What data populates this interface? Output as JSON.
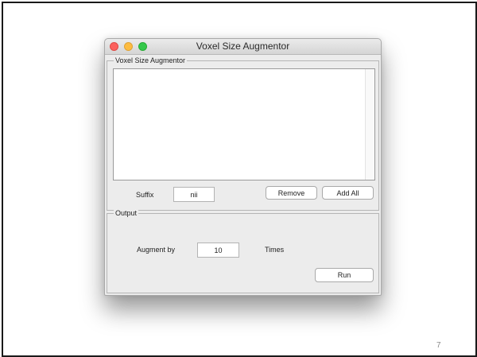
{
  "window": {
    "title": "Voxel Size Augmentor"
  },
  "input_panel": {
    "legend": "Voxel Size Augmentor",
    "suffix_label": "Suffix",
    "suffix_value": "nii",
    "remove_label": "Remove",
    "add_all_label": "Add All"
  },
  "output_panel": {
    "legend": "Output",
    "augment_label": "Augment by",
    "augment_value": "10",
    "times_label": "Times",
    "run_label": "Run"
  },
  "slide": {
    "page_number": "7"
  },
  "colors": {
    "close": "#fc615d",
    "minimize": "#fdbc40",
    "maximize": "#34c84a"
  }
}
